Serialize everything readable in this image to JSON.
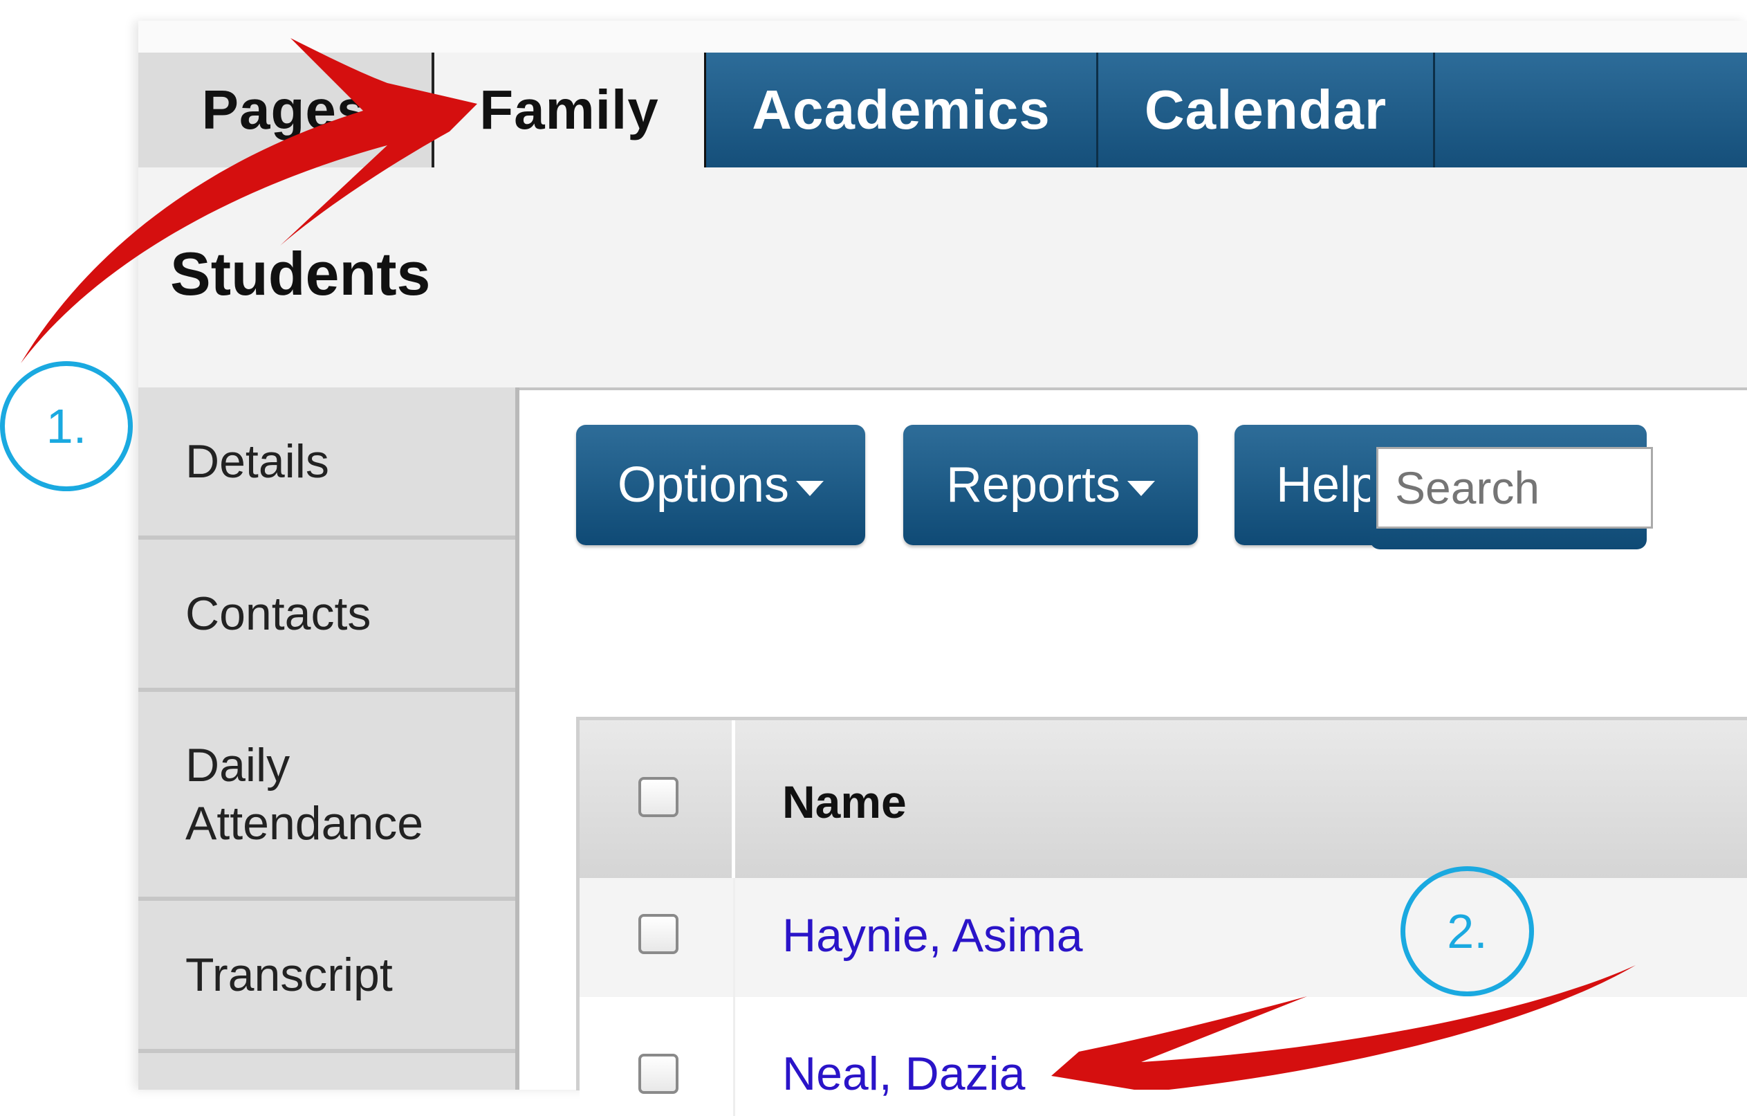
{
  "tabs": {
    "pages": "Pages",
    "family": "Family",
    "academics": "Academics",
    "calendar": "Calendar"
  },
  "page_title": "Students",
  "sidebar": {
    "items": [
      {
        "label": "Details"
      },
      {
        "label": "Contacts"
      },
      {
        "label": "Daily Attendance"
      },
      {
        "label": "Transcript"
      }
    ]
  },
  "toolbar": {
    "options_label": "Options",
    "reports_label": "Reports",
    "help_label": "Help",
    "search_placeholder": "Search"
  },
  "table": {
    "name_header": "Name",
    "rows": [
      {
        "name": "Haynie, Asima"
      },
      {
        "name": "Neal, Dazia"
      }
    ]
  },
  "annotations": {
    "step1": "1.",
    "step2": "2."
  },
  "colors": {
    "tab_blue": "#154f7a",
    "link": "#2a14c8",
    "callout": "#1aa9e0",
    "arrow": "#d50f0f"
  }
}
